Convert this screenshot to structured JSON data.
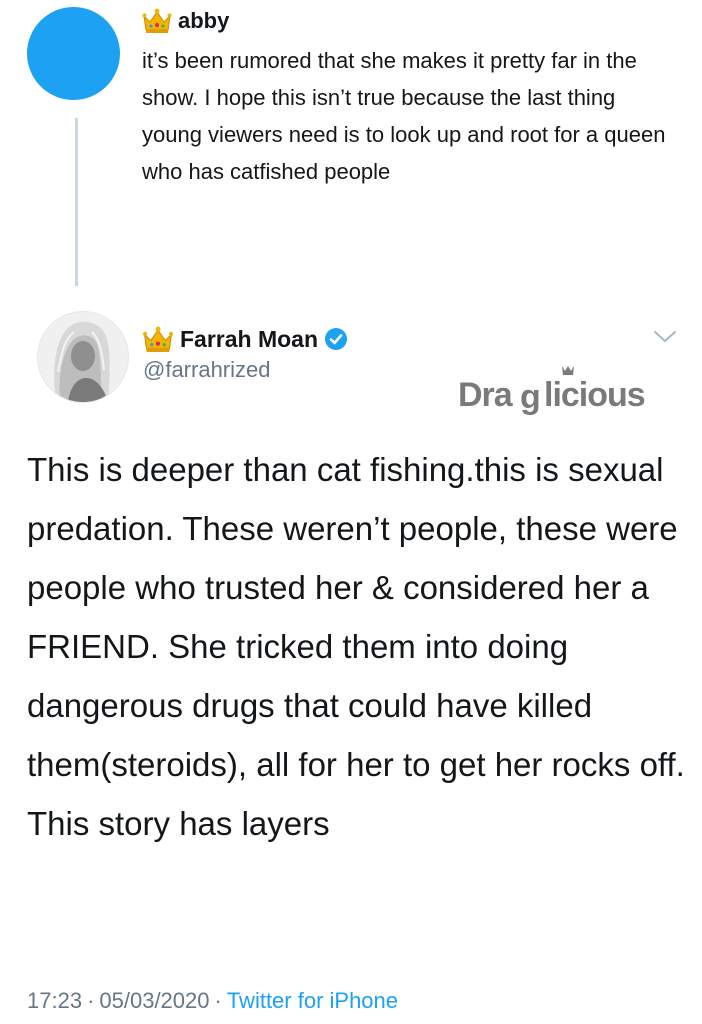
{
  "parent_tweet": {
    "display_name": "abby",
    "text": "it’s been rumored that she makes it pretty far in the show. I hope this isn’t true because the last thing young viewers need is to look up and root for a queen who has catfished people",
    "avatar_color": "#1da1f2",
    "name_icon": "crown-icon"
  },
  "main_tweet": {
    "display_name": "Farrah Moan",
    "handle": "@farrahrized",
    "verified": true,
    "name_icon": "crown-icon",
    "text": "This is deeper than cat fishing.this is sexual predation. These weren’t people, these were people who trusted her & considered her a FRIEND. She tricked them into doing dangerous drugs that could have killed them(steroids), all for her to get her rocks off. This story has layers",
    "time": "17:23",
    "separator": "·",
    "date": "05/03/2020",
    "source": "Twitter for iPhone"
  },
  "watermark": {
    "logo": "Draglicious",
    "color": "#7a7a7a"
  },
  "colors": {
    "link": "#1da1f2",
    "muted": "#657786",
    "text": "#14171a",
    "thread_line": "#ccd6dd"
  }
}
